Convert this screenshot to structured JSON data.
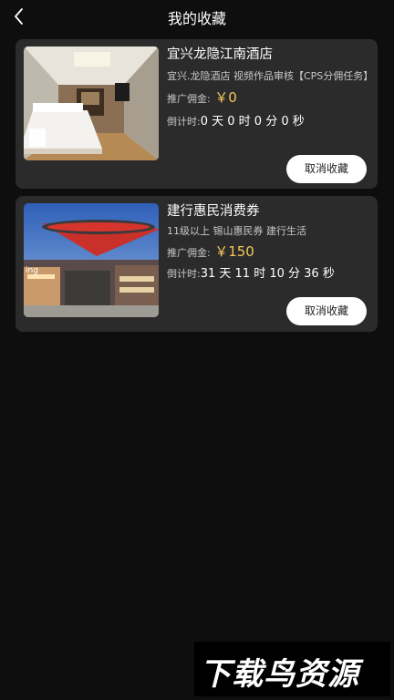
{
  "header": {
    "title": "我的收藏",
    "back_icon": "chevron-left-icon"
  },
  "favorites": [
    {
      "title": "宜兴龙隐江南酒店",
      "description": "宜兴.龙隐酒店 视频作品审核【CPS分佣任务】",
      "commission_label": "推广佣金:",
      "commission_value": "￥0",
      "countdown_label": "倒计时:",
      "countdown_value": "0 天 0 时 0 分 0 秒",
      "button_label": "取消收藏",
      "image": "hotel-room-photo"
    },
    {
      "title": "建行惠民消费券",
      "description": "11级以上 锡山惠民券 建行生活",
      "commission_label": "推广佣金:",
      "commission_value": "￥150",
      "countdown_label": "倒计时:",
      "countdown_value": "31 天 11 时 10 分 36 秒",
      "button_label": "取消收藏",
      "image": "shopping-mall-photo"
    }
  ],
  "watermark": {
    "text": "下载鸟资源"
  },
  "colors": {
    "background": "#0e0e0e",
    "card": "#2b2b2b",
    "accent": "#f5c85a"
  }
}
